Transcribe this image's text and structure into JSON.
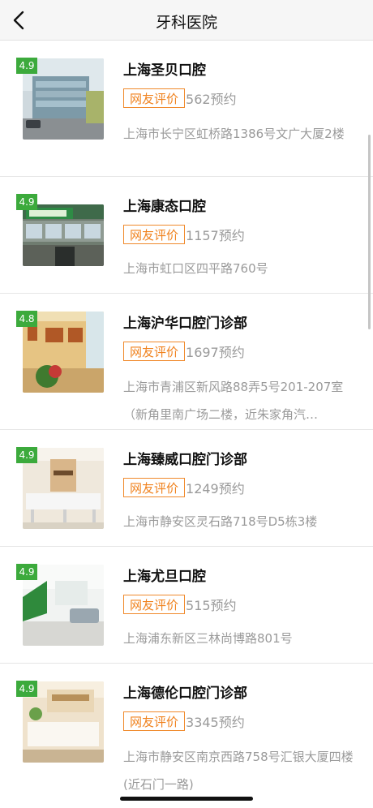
{
  "nav": {
    "title": "牙科医院",
    "back_icon": "chevron-left-icon"
  },
  "clinics": [
    {
      "rating": "4.9",
      "name": "上海圣贝口腔",
      "tag": "网友评价",
      "bookings": "562预约",
      "address": "上海市长宁区虹桥路1386号文广大厦2楼"
    },
    {
      "rating": "4.9",
      "name": "上海康态口腔",
      "tag": "网友评价",
      "bookings": "1157预约",
      "address": "上海市虹口区四平路760号"
    },
    {
      "rating": "4.8",
      "name": "上海沪华口腔门诊部",
      "tag": "网友评价",
      "bookings": "1697预约",
      "address": "上海市青浦区新风路88弄5号201-207室（新角里南广场二楼，近朱家角汽…"
    },
    {
      "rating": "4.9",
      "name": "上海臻威口腔门诊部",
      "tag": "网友评价",
      "bookings": "1249预约",
      "address": "上海市静安区灵石路718号D5栋3楼"
    },
    {
      "rating": "4.9",
      "name": "上海尤旦口腔",
      "tag": "网友评价",
      "bookings": "515预约",
      "address": "上海浦东新区三林尚博路801号"
    },
    {
      "rating": "4.9",
      "name": "上海德伦口腔门诊部",
      "tag": "网友评价",
      "bookings": "3345预约",
      "address": "上海市静安区南京西路758号汇银大厦四楼(近石门一路)"
    }
  ],
  "colors": {
    "rating_bg": "#3caa3c",
    "tag_orange": "#f0821e",
    "gray_text": "#9a9a9a"
  }
}
